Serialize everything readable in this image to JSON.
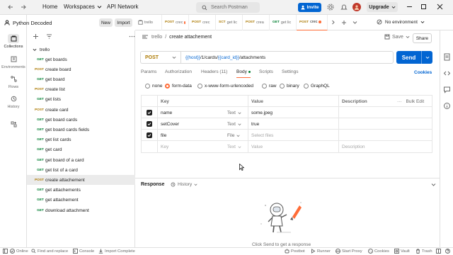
{
  "titlebar": {
    "home": "Home",
    "workspaces": "Workspaces",
    "api_network": "API Network",
    "search_placeholder": "Search Postman",
    "invite": "Invite",
    "upgrade": "Upgrade"
  },
  "workspace": {
    "name": "Python Decoded",
    "new_label": "New",
    "import_label": "Import"
  },
  "rail": {
    "items": [
      {
        "label": "Collections",
        "icon": "collections-icon"
      },
      {
        "label": "Environments",
        "icon": "environments-icon"
      },
      {
        "label": "Flows",
        "icon": "flows-icon"
      },
      {
        "label": "History",
        "icon": "history-icon"
      }
    ]
  },
  "sidebar": {
    "collection": "trello",
    "items": [
      {
        "method": "GET",
        "name": "get boards"
      },
      {
        "method": "POST",
        "name": "create board"
      },
      {
        "method": "GET",
        "name": "get board"
      },
      {
        "method": "POST",
        "name": "create list"
      },
      {
        "method": "GET",
        "name": "get lists"
      },
      {
        "method": "POST",
        "name": "create card"
      },
      {
        "method": "GET",
        "name": "get board cards"
      },
      {
        "method": "GET",
        "name": "get board cards fields"
      },
      {
        "method": "GET",
        "name": "get list cards"
      },
      {
        "method": "GET",
        "name": "get card"
      },
      {
        "method": "GET",
        "name": "get board of a card"
      },
      {
        "method": "GET",
        "name": "get list of a card"
      },
      {
        "method": "POST",
        "name": "create attachement"
      },
      {
        "method": "GET",
        "name": "get attachements"
      },
      {
        "method": "GET",
        "name": "get attachement"
      },
      {
        "method": "GET",
        "name": "download attachment"
      }
    ]
  },
  "tabs": [
    {
      "method": "",
      "label": "trello",
      "dot": false
    },
    {
      "method": "POST",
      "label": "crec",
      "dot": true
    },
    {
      "method": "POST",
      "label": "crec",
      "dot": false
    },
    {
      "method": "SCT",
      "label": "get lic",
      "dot": false
    },
    {
      "method": "POST",
      "label": "crea",
      "dot": false
    },
    {
      "method": "GET",
      "label": "get lic",
      "dot": false
    },
    {
      "method": "POST",
      "label": "crec",
      "dot": true
    }
  ],
  "environment": "No environment",
  "request": {
    "breadcrumb_parent": "trello",
    "breadcrumb_sep": "/",
    "title": "create attachement",
    "save_label": "Save",
    "share_label": "Share",
    "method": "POST",
    "url_host": "{{host}}",
    "url_mid": "/1/cards/",
    "url_var": "{{card_id}}",
    "url_tail": "/attachments",
    "send_label": "Send",
    "tabs": [
      "Params",
      "Authorization",
      "Headers (11)",
      "Body",
      "Scripts",
      "Settings"
    ],
    "cookies_label": "Cookies",
    "body_modes": [
      "none",
      "form-data",
      "x-www-form-urlencoded",
      "raw",
      "binary",
      "GraphQL"
    ]
  },
  "form_table": {
    "headers": [
      "Key",
      "Value",
      "Description"
    ],
    "bulk_edit": "Bulk Edit",
    "rows": [
      {
        "key": "name",
        "type": "Text",
        "value": "some.jpeg",
        "checked": true
      },
      {
        "key": "setCover",
        "type": "Text",
        "value": "true",
        "checked": true
      },
      {
        "key": "file",
        "type": "File",
        "value": "Select files",
        "checked": true,
        "value_placeholder": true
      }
    ],
    "new_row": {
      "key": "Key",
      "type": "Text",
      "value": "Value",
      "description": "Description"
    }
  },
  "response": {
    "title": "Response",
    "history": "History",
    "empty_text": "Click Send to get a response"
  },
  "statusbar": {
    "online": "Online",
    "find_replace": "Find and replace",
    "console": "Console",
    "import_complete": "Import Complete",
    "postbot": "Postbot",
    "runner": "Runner",
    "start_proxy": "Start Proxy",
    "cookies": "Cookies",
    "vault": "Vault",
    "trash": "Trash"
  },
  "colors": {
    "accent": "#ff6c37",
    "primary": "#0265d2",
    "get": "#007f31",
    "post": "#ad7a03"
  }
}
